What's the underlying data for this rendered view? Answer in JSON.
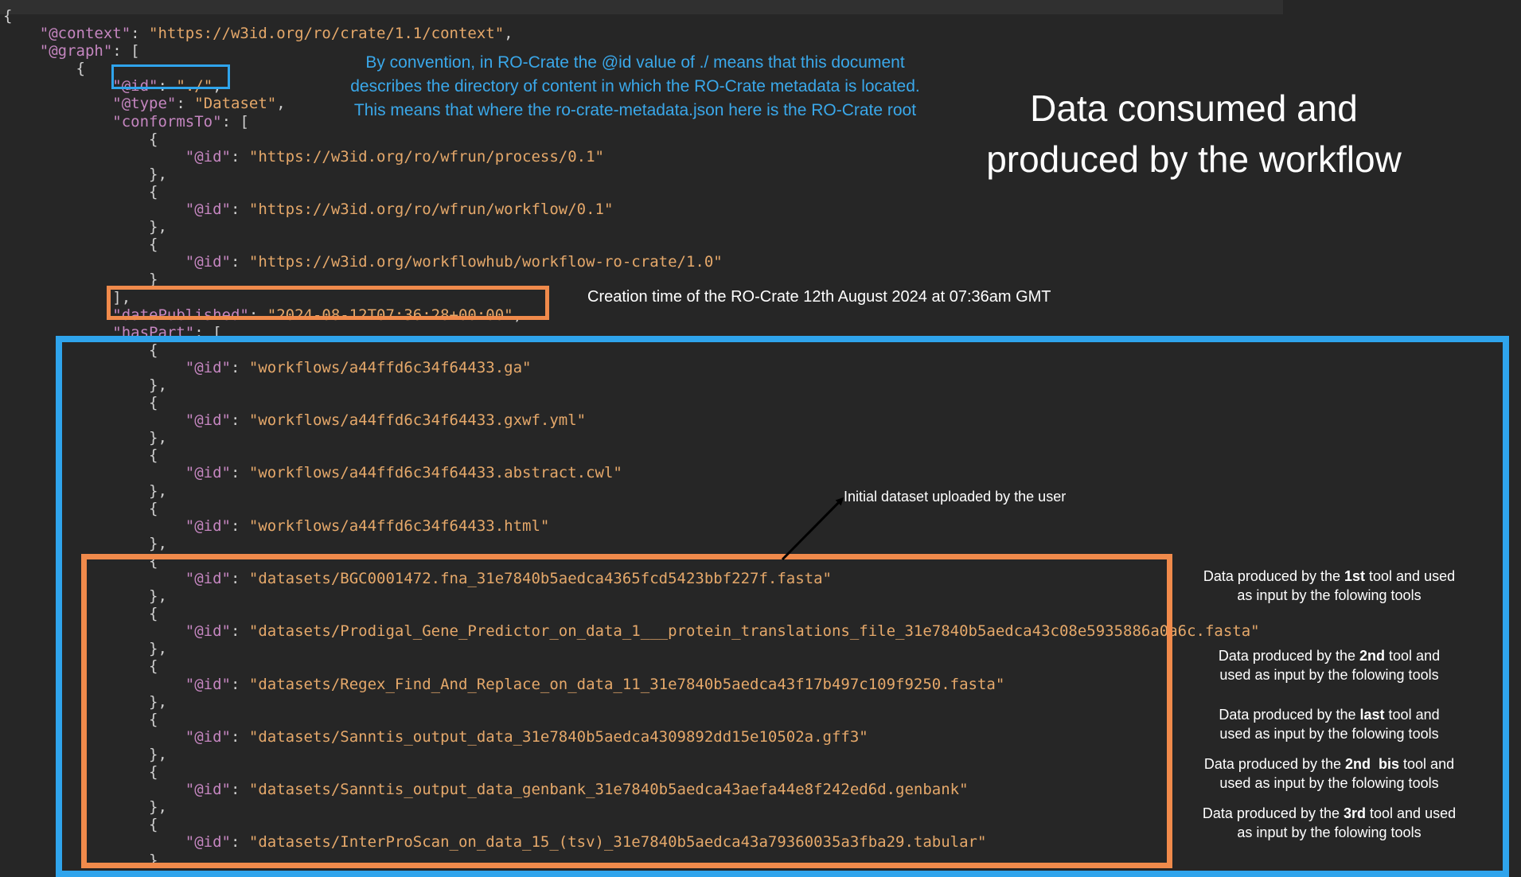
{
  "code_lines": [
    {
      "indent": 0,
      "parts": [
        {
          "t": "punc",
          "v": "{"
        }
      ]
    },
    {
      "indent": 1,
      "parts": [
        {
          "t": "key",
          "v": "\"@context\""
        },
        {
          "t": "punc",
          "v": ": "
        },
        {
          "t": "str",
          "v": "\"https://w3id.org/ro/crate/1.1/context\""
        },
        {
          "t": "punc",
          "v": ","
        }
      ]
    },
    {
      "indent": 1,
      "parts": [
        {
          "t": "key",
          "v": "\"@graph\""
        },
        {
          "t": "punc",
          "v": ": ["
        }
      ]
    },
    {
      "indent": 2,
      "parts": [
        {
          "t": "punc",
          "v": "{"
        }
      ]
    },
    {
      "indent": 3,
      "parts": [
        {
          "t": "key",
          "v": "\"@id\""
        },
        {
          "t": "punc",
          "v": ": "
        },
        {
          "t": "str",
          "v": "\"./\""
        },
        {
          "t": "punc",
          "v": ","
        }
      ]
    },
    {
      "indent": 3,
      "parts": [
        {
          "t": "key",
          "v": "\"@type\""
        },
        {
          "t": "punc",
          "v": ": "
        },
        {
          "t": "str",
          "v": "\"Dataset\""
        },
        {
          "t": "punc",
          "v": ","
        }
      ]
    },
    {
      "indent": 3,
      "parts": [
        {
          "t": "key",
          "v": "\"conformsTo\""
        },
        {
          "t": "punc",
          "v": ": ["
        }
      ]
    },
    {
      "indent": 4,
      "parts": [
        {
          "t": "punc",
          "v": "{"
        }
      ]
    },
    {
      "indent": 5,
      "parts": [
        {
          "t": "key",
          "v": "\"@id\""
        },
        {
          "t": "punc",
          "v": ": "
        },
        {
          "t": "str",
          "v": "\"https://w3id.org/ro/wfrun/process/0.1\""
        }
      ]
    },
    {
      "indent": 4,
      "parts": [
        {
          "t": "punc",
          "v": "},"
        }
      ]
    },
    {
      "indent": 4,
      "parts": [
        {
          "t": "punc",
          "v": "{"
        }
      ]
    },
    {
      "indent": 5,
      "parts": [
        {
          "t": "key",
          "v": "\"@id\""
        },
        {
          "t": "punc",
          "v": ": "
        },
        {
          "t": "str",
          "v": "\"https://w3id.org/ro/wfrun/workflow/0.1\""
        }
      ]
    },
    {
      "indent": 4,
      "parts": [
        {
          "t": "punc",
          "v": "},"
        }
      ]
    },
    {
      "indent": 4,
      "parts": [
        {
          "t": "punc",
          "v": "{"
        }
      ]
    },
    {
      "indent": 5,
      "parts": [
        {
          "t": "key",
          "v": "\"@id\""
        },
        {
          "t": "punc",
          "v": ": "
        },
        {
          "t": "str",
          "v": "\"https://w3id.org/workflowhub/workflow-ro-crate/1.0\""
        }
      ]
    },
    {
      "indent": 4,
      "parts": [
        {
          "t": "punc",
          "v": "}"
        }
      ]
    },
    {
      "indent": 3,
      "parts": [
        {
          "t": "punc",
          "v": "],"
        }
      ]
    },
    {
      "indent": 3,
      "parts": [
        {
          "t": "key",
          "v": "\"datePublished\""
        },
        {
          "t": "punc",
          "v": ": "
        },
        {
          "t": "str",
          "v": "\"2024-08-12T07:36:28+00:00\""
        },
        {
          "t": "punc",
          "v": ","
        }
      ]
    },
    {
      "indent": 3,
      "parts": [
        {
          "t": "key",
          "v": "\"hasPart\""
        },
        {
          "t": "punc",
          "v": ": ["
        }
      ]
    },
    {
      "indent": 4,
      "parts": [
        {
          "t": "punc",
          "v": "{"
        }
      ]
    },
    {
      "indent": 5,
      "parts": [
        {
          "t": "key",
          "v": "\"@id\""
        },
        {
          "t": "punc",
          "v": ": "
        },
        {
          "t": "str",
          "v": "\"workflows/a44ffd6c34f64433.ga\""
        }
      ]
    },
    {
      "indent": 4,
      "parts": [
        {
          "t": "punc",
          "v": "},"
        }
      ]
    },
    {
      "indent": 4,
      "parts": [
        {
          "t": "punc",
          "v": "{"
        }
      ]
    },
    {
      "indent": 5,
      "parts": [
        {
          "t": "key",
          "v": "\"@id\""
        },
        {
          "t": "punc",
          "v": ": "
        },
        {
          "t": "str",
          "v": "\"workflows/a44ffd6c34f64433.gxwf.yml\""
        }
      ]
    },
    {
      "indent": 4,
      "parts": [
        {
          "t": "punc",
          "v": "},"
        }
      ]
    },
    {
      "indent": 4,
      "parts": [
        {
          "t": "punc",
          "v": "{"
        }
      ]
    },
    {
      "indent": 5,
      "parts": [
        {
          "t": "key",
          "v": "\"@id\""
        },
        {
          "t": "punc",
          "v": ": "
        },
        {
          "t": "str",
          "v": "\"workflows/a44ffd6c34f64433.abstract.cwl\""
        }
      ]
    },
    {
      "indent": 4,
      "parts": [
        {
          "t": "punc",
          "v": "},"
        }
      ]
    },
    {
      "indent": 4,
      "parts": [
        {
          "t": "punc",
          "v": "{"
        }
      ]
    },
    {
      "indent": 5,
      "parts": [
        {
          "t": "key",
          "v": "\"@id\""
        },
        {
          "t": "punc",
          "v": ": "
        },
        {
          "t": "str",
          "v": "\"workflows/a44ffd6c34f64433.html\""
        }
      ]
    },
    {
      "indent": 4,
      "parts": [
        {
          "t": "punc",
          "v": "},"
        }
      ]
    },
    {
      "indent": 4,
      "parts": [
        {
          "t": "punc",
          "v": "{"
        }
      ]
    },
    {
      "indent": 5,
      "parts": [
        {
          "t": "key",
          "v": "\"@id\""
        },
        {
          "t": "punc",
          "v": ": "
        },
        {
          "t": "str",
          "v": "\"datasets/BGC0001472.fna_31e7840b5aedca4365fcd5423bbf227f.fasta\""
        }
      ]
    },
    {
      "indent": 4,
      "parts": [
        {
          "t": "punc",
          "v": "},"
        }
      ]
    },
    {
      "indent": 4,
      "parts": [
        {
          "t": "punc",
          "v": "{"
        }
      ]
    },
    {
      "indent": 5,
      "parts": [
        {
          "t": "key",
          "v": "\"@id\""
        },
        {
          "t": "punc",
          "v": ": "
        },
        {
          "t": "str",
          "v": "\"datasets/Prodigal_Gene_Predictor_on_data_1___protein_translations_file_31e7840b5aedca43c08e5935886a0a6c.fasta\""
        }
      ]
    },
    {
      "indent": 4,
      "parts": [
        {
          "t": "punc",
          "v": "},"
        }
      ]
    },
    {
      "indent": 4,
      "parts": [
        {
          "t": "punc",
          "v": "{"
        }
      ]
    },
    {
      "indent": 5,
      "parts": [
        {
          "t": "key",
          "v": "\"@id\""
        },
        {
          "t": "punc",
          "v": ": "
        },
        {
          "t": "str",
          "v": "\"datasets/Regex_Find_And_Replace_on_data_11_31e7840b5aedca43f17b497c109f9250.fasta\""
        }
      ]
    },
    {
      "indent": 4,
      "parts": [
        {
          "t": "punc",
          "v": "},"
        }
      ]
    },
    {
      "indent": 4,
      "parts": [
        {
          "t": "punc",
          "v": "{"
        }
      ]
    },
    {
      "indent": 5,
      "parts": [
        {
          "t": "key",
          "v": "\"@id\""
        },
        {
          "t": "punc",
          "v": ": "
        },
        {
          "t": "str",
          "v": "\"datasets/Sanntis_output_data_31e7840b5aedca4309892dd15e10502a.gff3\""
        }
      ]
    },
    {
      "indent": 4,
      "parts": [
        {
          "t": "punc",
          "v": "},"
        }
      ]
    },
    {
      "indent": 4,
      "parts": [
        {
          "t": "punc",
          "v": "{"
        }
      ]
    },
    {
      "indent": 5,
      "parts": [
        {
          "t": "key",
          "v": "\"@id\""
        },
        {
          "t": "punc",
          "v": ": "
        },
        {
          "t": "str",
          "v": "\"datasets/Sanntis_output_data_genbank_31e7840b5aedca43aefa44e8f242ed6d.genbank\""
        }
      ]
    },
    {
      "indent": 4,
      "parts": [
        {
          "t": "punc",
          "v": "},"
        }
      ]
    },
    {
      "indent": 4,
      "parts": [
        {
          "t": "punc",
          "v": "{"
        }
      ]
    },
    {
      "indent": 5,
      "parts": [
        {
          "t": "key",
          "v": "\"@id\""
        },
        {
          "t": "punc",
          "v": ": "
        },
        {
          "t": "str",
          "v": "\"datasets/InterProScan_on_data_15_(tsv)_31e7840b5aedca43a79360035a3fba29.tabular\""
        }
      ]
    },
    {
      "indent": 4,
      "parts": [
        {
          "t": "punc",
          "v": "},"
        }
      ]
    }
  ],
  "annotations": {
    "convention_note": {
      "lines": [
        "By convention, in RO-Crate the @id value of ./ means that this document",
        "describes the directory of content in which the RO-Crate metadata is located.",
        "This means that where the ro-crate-metadata.json here is the RO-Crate root"
      ]
    },
    "heading": {
      "line1": "Data consumed and",
      "line2": "produced by the workflow"
    },
    "creation_note": "Creation time of the RO-Crate 12th August 2024 at 07:36am GMT",
    "initial_dataset_note": "Initial dataset uploaded by the user",
    "tool_notes": [
      {
        "pre": "Data produced by the ",
        "bold": "1st",
        "post": " tool and used",
        "line2": "as input by the folowing tools"
      },
      {
        "pre": "Data produced by the ",
        "bold": "2nd",
        "post": " tool and",
        "line2": "used as input by the folowing tools"
      },
      {
        "pre": "Data produced by the ",
        "bold": "last",
        "post": " tool and",
        "line2": "used as input by the folowing tools"
      },
      {
        "pre": "Data produced by the ",
        "bold": "2nd  bis",
        "post": " tool and",
        "line2": "used as input by the folowing tools"
      },
      {
        "pre": "Data produced by the ",
        "bold": "3rd",
        "post": " tool and used",
        "line2": "as input by the folowing tools"
      }
    ]
  },
  "colors": {
    "background": "#262626",
    "highlight_blue": "#2fa4ec",
    "highlight_orange": "#f08a4b",
    "note_blue": "#3aa8ea",
    "json_key": "#c586c0",
    "json_string": "#e5a86a"
  }
}
